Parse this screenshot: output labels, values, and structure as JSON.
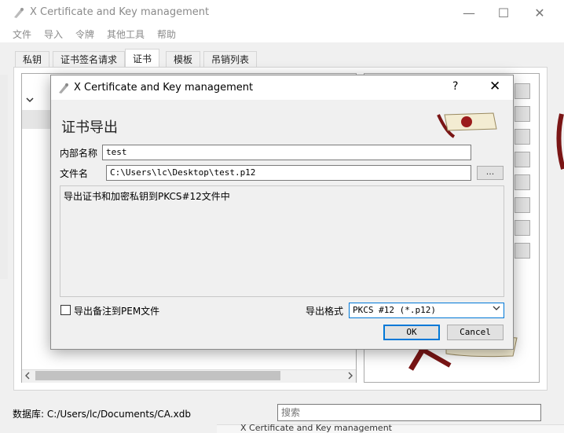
{
  "main_window": {
    "title": "X Certificate and Key management",
    "controls": {
      "minimize": "—",
      "maximize": "☐",
      "close": "✕"
    },
    "menu": [
      "文件",
      "导入",
      "令牌",
      "其他工具",
      "帮助"
    ],
    "tabs": [
      "私钥",
      "证书签名请求",
      "证书",
      "模板",
      "吊销列表"
    ],
    "active_tab": "证书",
    "status": {
      "database_path": "数据库: C:/Users/lc/Documents/CA.xdb"
    },
    "search": {
      "placeholder": "搜索"
    },
    "background_window_title": "X Certificate and Key management"
  },
  "dialog": {
    "title": "X Certificate and Key management",
    "help": "?",
    "close": "✕",
    "heading": "证书导出",
    "internal_name_label": "内部名称",
    "internal_name_value": "test",
    "filename_label": "文件名",
    "filename_value": "C:\\Users\\lc\\Desktop\\test.p12",
    "browse_label": "...",
    "description": "导出证书和加密私钥到PKCS#12文件中",
    "pem_comment_label": "导出备注到PEM文件",
    "pem_comment_checked": false,
    "format_label": "导出格式",
    "format_value": "PKCS #12 (*.p12)",
    "ok_label": "OK",
    "cancel_label": "Cancel"
  },
  "colors": {
    "accent": "#0078d7",
    "logo": "#8b1a1a"
  }
}
